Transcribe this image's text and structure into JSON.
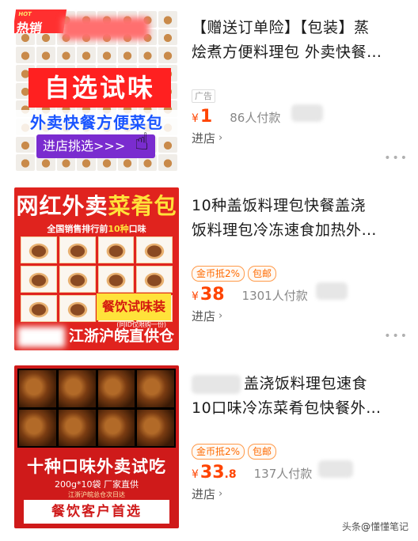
{
  "items": [
    {
      "title_line1": "【赠送订单险】【包装】蒸",
      "title_line2": "烩煮方便料理包 外卖快餐…",
      "ad_label": "广告",
      "price_currency": "¥",
      "price_int": "1",
      "price_dec": "",
      "sold": "86人付款",
      "shop_label": "进店",
      "thumb": {
        "hot": "热销",
        "hot_en": "HOT",
        "band": "自选试味",
        "blue": "外卖快餐方便菜包",
        "cta": "进店挑选>>>"
      }
    },
    {
      "title_line1": "10种盖饭料理包快餐盖浇",
      "title_line2": "饭料理包冷冻速食加热外…",
      "tags": [
        "金币抵2%",
        "包邮"
      ],
      "price_currency": "¥",
      "price_int": "38",
      "price_dec": "",
      "sold": "1301人付款",
      "shop_label": "进店",
      "thumb": {
        "head_a": "网红外卖",
        "head_b": "菜肴包",
        "sub_a": "全国销售排行前",
        "sub_b": "10种",
        "sub_c": "口味",
        "yellow": "餐饮试味装",
        "note": "(同ID仅限购一份)",
        "foot": "江浙沪皖直供仓"
      }
    },
    {
      "title_line1": "盖浇饭料理包速食",
      "title_line2": "10口味冷冻菜肴包快餐外…",
      "tags": [
        "金币抵2%",
        "包邮"
      ],
      "price_currency": "¥",
      "price_int": "33",
      "price_dec": ".8",
      "sold": "137人付款",
      "shop_label": "进店",
      "thumb": {
        "big": "十种口味外卖试吃",
        "mid": "200g*10袋  厂家直供",
        "small": "江浙沪皖总仓次日达",
        "band": "餐饮客户首选"
      }
    }
  ],
  "watermark": {
    "prefix": "头条",
    "at": "@",
    "name": "懂懂笔记"
  }
}
